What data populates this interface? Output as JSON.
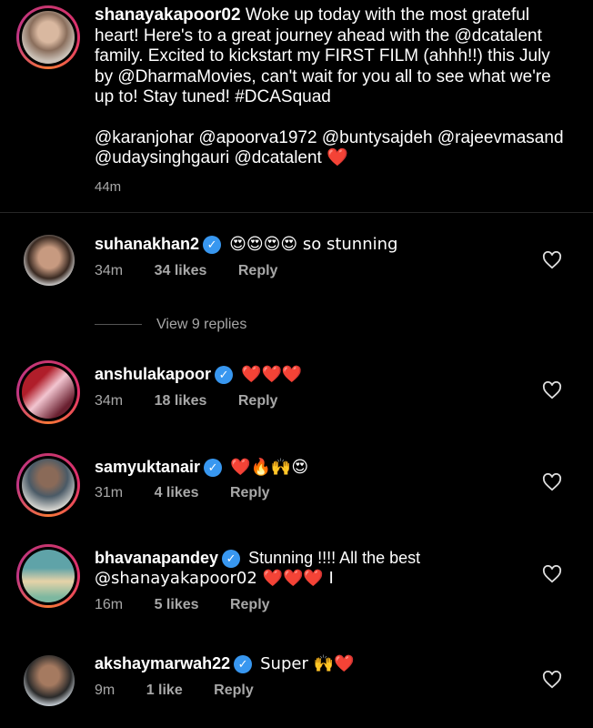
{
  "caption": {
    "username": "shanayakapoor02",
    "text": "Woke up today with the most grateful heart! Here's to a great journey ahead with the @dcatalent family. Excited to kickstart my FIRST FILM (ahhh!!) this July by @DharmaMovies, can't wait for you all to see what we're up to! Stay tuned! #DCASquad",
    "mentions": "@karanjohar @apoorva1972 @buntysajdeh @rajeevmasand @udaysinghgauri @dcatalent ❤️",
    "time": "44m"
  },
  "comments": [
    {
      "username": "suhanakhan2",
      "verified": true,
      "text": "😍😍😍😍 so stunning",
      "time": "34m",
      "likes": "34 likes",
      "reply": "Reply"
    },
    {
      "username": "anshulakapoor",
      "verified": true,
      "text": "❤️❤️❤️",
      "time": "34m",
      "likes": "18 likes",
      "reply": "Reply"
    },
    {
      "username": "samyuktanair",
      "verified": true,
      "text": "❤️🔥🙌😍",
      "time": "31m",
      "likes": "4 likes",
      "reply": "Reply"
    },
    {
      "username": "bhavanapandey",
      "verified": true,
      "text": "Stunning !!!! All the best",
      "text2": "@shanayakapoor02 ❤️❤️❤️ I",
      "time": "16m",
      "likes": "5 likes",
      "reply": "Reply"
    },
    {
      "username": "akshaymarwah22",
      "verified": true,
      "text": "Super 🙌❤️",
      "time": "9m",
      "likes": "1 like",
      "reply": "Reply"
    }
  ],
  "view_replies": "View 9 replies",
  "colors": {
    "background": "#000000",
    "verified": "#3897f0",
    "muted": "#a8a8a8",
    "heart": "#e0263a"
  },
  "icons": {
    "like": "heart-outline-icon",
    "verified": "verified-badge-icon"
  }
}
